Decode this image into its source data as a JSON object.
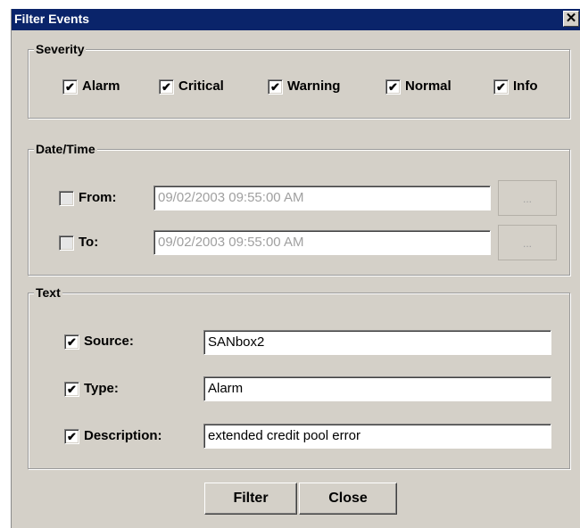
{
  "window": {
    "title": "Filter Events",
    "close_glyph": "✕"
  },
  "severity": {
    "legend": "Severity",
    "items": [
      {
        "label": "Alarm",
        "checked": true
      },
      {
        "label": "Critical",
        "checked": true
      },
      {
        "label": "Warning",
        "checked": true
      },
      {
        "label": "Normal",
        "checked": true
      },
      {
        "label": "Info",
        "checked": true
      }
    ]
  },
  "datetime": {
    "legend": "Date/Time",
    "from": {
      "label": "From:",
      "checked": false,
      "value": "09/02/2003 09:55:00 AM",
      "button": "..."
    },
    "to": {
      "label": "To:",
      "checked": false,
      "value": "09/02/2003 09:55:00 AM",
      "button": "..."
    }
  },
  "text": {
    "legend": "Text",
    "source": {
      "label": "Source:",
      "checked": true,
      "value": "SANbox2"
    },
    "type": {
      "label": "Type:",
      "checked": true,
      "value": "Alarm"
    },
    "description": {
      "label": "Description:",
      "checked": true,
      "value": "extended credit pool error"
    }
  },
  "buttons": {
    "filter": "Filter",
    "close": "Close"
  },
  "check_glyph": "✔"
}
